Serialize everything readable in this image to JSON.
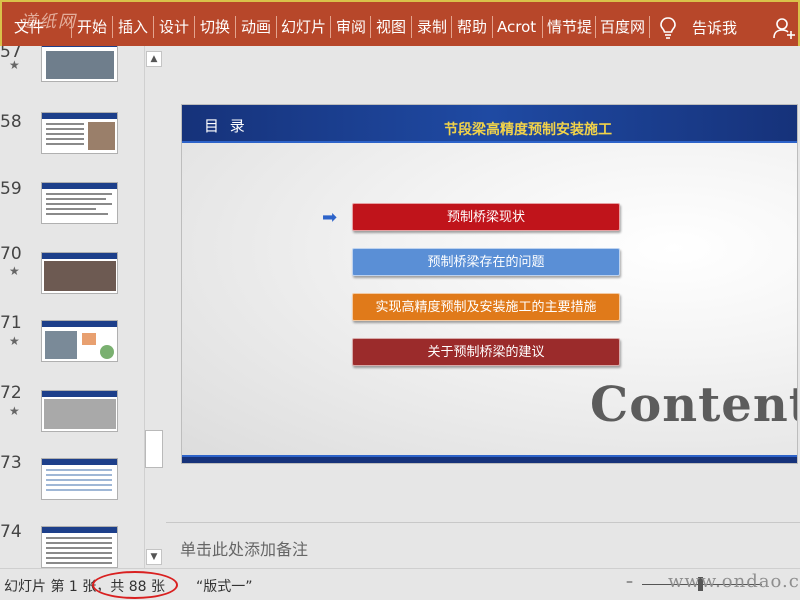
{
  "ribbon": {
    "watermark": "道纸网",
    "tabs": [
      {
        "label": "文件"
      },
      {
        "label": "开始"
      },
      {
        "label": "插入"
      },
      {
        "label": "设计"
      },
      {
        "label": "切换"
      },
      {
        "label": "动画"
      },
      {
        "label": "幻灯片"
      },
      {
        "label": "审阅"
      },
      {
        "label": "视图"
      },
      {
        "label": "录制"
      },
      {
        "label": "帮助"
      },
      {
        "label": "Acrot"
      },
      {
        "label": "情节提"
      },
      {
        "label": "百度网"
      }
    ],
    "tell_me": "告诉我",
    "colors": {
      "ribbon": "#b7472a"
    }
  },
  "thumbnails": [
    {
      "num": "57",
      "star": "★"
    },
    {
      "num": "58",
      "star": ""
    },
    {
      "num": "59",
      "star": ""
    },
    {
      "num": "70",
      "star": "★"
    },
    {
      "num": "71",
      "star": "★"
    },
    {
      "num": "72",
      "star": "★"
    },
    {
      "num": "73",
      "star": ""
    },
    {
      "num": "74",
      "star": ""
    }
  ],
  "slide": {
    "band_title": "目 录",
    "band_subtitle": "节段梁高精度预制安装施工",
    "items": [
      {
        "label": "预制桥梁现状",
        "color": "#c0141b"
      },
      {
        "label": "预制桥梁存在的问题",
        "color": "#5a8fd6"
      },
      {
        "label": "实现高精度预制及安装施工的主要措施",
        "color": "#e07a1a"
      },
      {
        "label": "关于预制桥梁的建议",
        "color": "#9b2b2b"
      }
    ],
    "contents_word": "Contents"
  },
  "notes": {
    "placeholder": "单击此处添加备注"
  },
  "status": {
    "slide_info": "幻灯片 第 1 张，共 88 张",
    "layout_name": "“版式一”",
    "site": "www.ondao.com",
    "zoom_minus": "–"
  }
}
